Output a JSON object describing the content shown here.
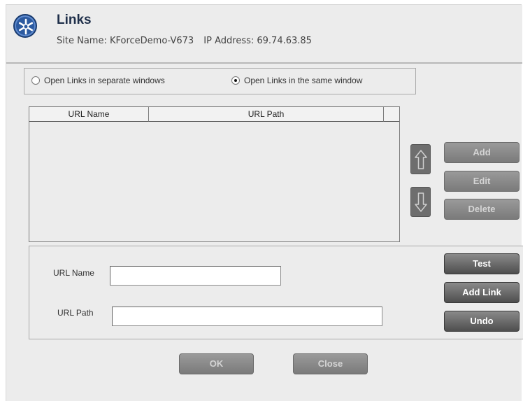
{
  "header": {
    "title": "Links",
    "site_name": "Site Name: KForceDemo-V673",
    "ip_address": "IP Address: 69.74.63.85",
    "logo_icon": "asterisk-logo-icon",
    "logo_color": "#2c5aa0"
  },
  "link_mode": {
    "options": [
      {
        "label": "Open Links in separate windows",
        "checked": false
      },
      {
        "label": "Open Links in the same window",
        "checked": true
      }
    ]
  },
  "table": {
    "columns": [
      "URL Name",
      "URL Path"
    ],
    "rows": []
  },
  "reorder": {
    "up_icon": "arrow-up-icon",
    "down_icon": "arrow-down-icon"
  },
  "list_actions": {
    "add": "Add",
    "edit": "Edit",
    "delete": "Delete"
  },
  "form": {
    "url_name_label": "URL Name",
    "url_name_value": "",
    "url_path_label": "URL Path",
    "url_path_value": "",
    "test": "Test",
    "add_link": "Add Link",
    "undo": "Undo"
  },
  "footer": {
    "ok": "OK",
    "close": "Close"
  }
}
